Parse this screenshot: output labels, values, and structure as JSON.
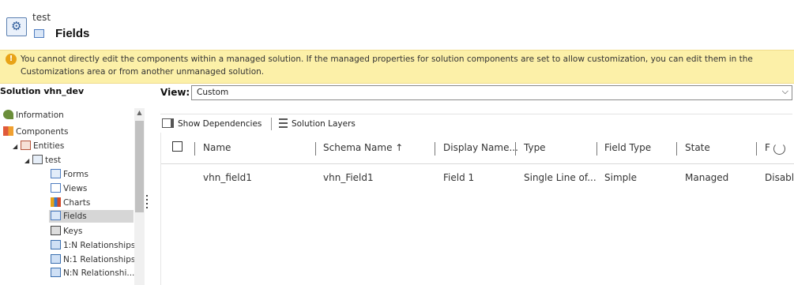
{
  "header": {
    "entity_name": "test",
    "page_title": "Fields"
  },
  "warning": {
    "text": "You cannot directly edit the components within a managed solution. If the managed properties for solution components are set to allow customization, you can edit them in the Customizations area or from another unmanaged solution."
  },
  "sidebar": {
    "solution_title": "Solution vhn_dev",
    "items": [
      {
        "label": "Information"
      },
      {
        "label": "Components"
      },
      {
        "label": "Entities"
      },
      {
        "label": "test"
      },
      {
        "label": "Forms"
      },
      {
        "label": "Views"
      },
      {
        "label": "Charts"
      },
      {
        "label": "Fields"
      },
      {
        "label": "Keys"
      },
      {
        "label": "1:N Relationships"
      },
      {
        "label": "N:1 Relationships"
      },
      {
        "label": "N:N Relationshi..."
      }
    ]
  },
  "view": {
    "label": "View:",
    "value": "Custom"
  },
  "toolbar": {
    "show_dependencies": "Show Dependencies",
    "solution_layers": "Solution Layers"
  },
  "grid": {
    "columns": [
      "Name",
      "Schema Name ↑",
      "Display Name...",
      "Type",
      "Field Type",
      "State",
      "F"
    ],
    "rows": [
      {
        "name": "vhn_field1",
        "schema_name": "vhn_Field1",
        "display_name": "Field 1",
        "type": "Single Line of...",
        "field_type": "Simple",
        "state": "Managed",
        "f": "Disabl"
      }
    ]
  },
  "colors": {
    "warning_bg": "#fcf0a8",
    "warning_icon": "#e8a317",
    "selected_bg": "#d6d6d6"
  }
}
